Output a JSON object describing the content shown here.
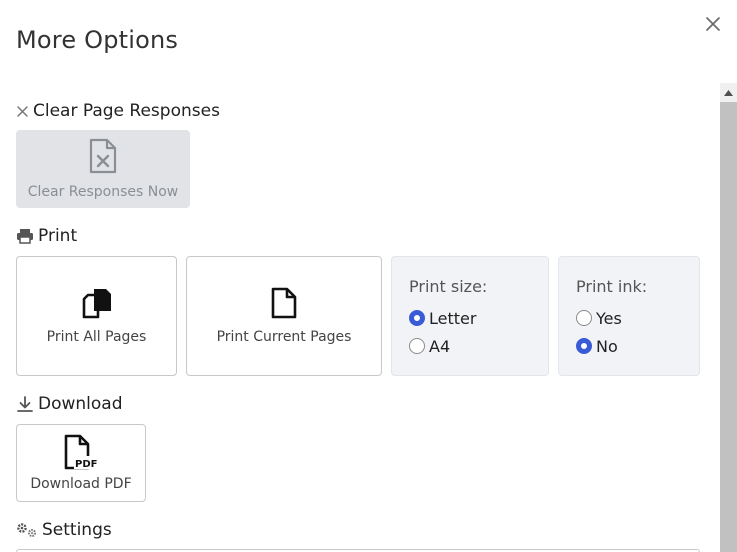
{
  "dialog": {
    "title": "More Options"
  },
  "clear": {
    "heading": "Clear Page Responses",
    "button_label": "Clear Responses Now"
  },
  "print": {
    "heading": "Print",
    "all_pages_label": "Print All Pages",
    "current_pages_label": "Print Current Pages",
    "size": {
      "heading": "Print size:",
      "options": [
        "Letter",
        "A4"
      ],
      "selected": "Letter"
    },
    "ink": {
      "heading": "Print ink:",
      "options": [
        "Yes",
        "No"
      ],
      "selected": "No"
    }
  },
  "download": {
    "heading": "Download",
    "pdf_label": "Download PDF"
  },
  "settings": {
    "heading": "Settings"
  },
  "colors": {
    "accent": "#3a5bd6",
    "disabled_bg": "#e1e3e6",
    "option_bg": "#f1f3f6"
  }
}
